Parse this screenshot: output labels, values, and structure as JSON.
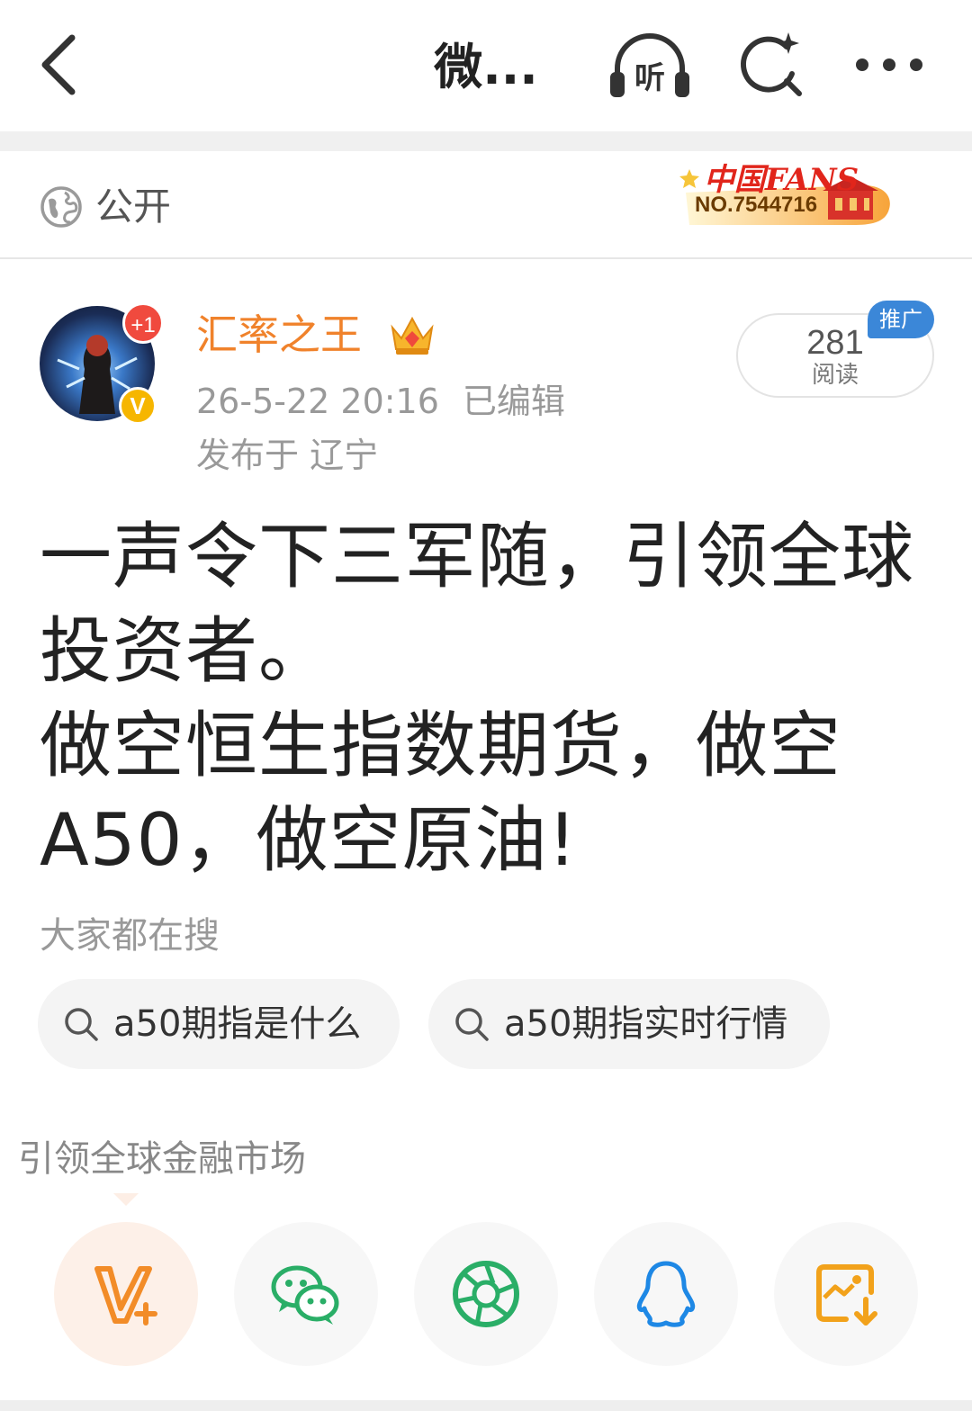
{
  "topbar": {
    "title": "微...",
    "listen_label": "听"
  },
  "visibility": {
    "label": "公开",
    "fans_badge": {
      "title": "中国FANS",
      "number": "NO.7544716"
    }
  },
  "author": {
    "name": "汇率之王",
    "plus_badge": "+1",
    "verified_badge": "V",
    "time": "26-5-22 20:16",
    "edited": "已编辑",
    "location": "发布于 辽宁"
  },
  "reads": {
    "count": "281",
    "label": "阅读",
    "promo_tag": "推广"
  },
  "post": {
    "line1": "一声令下三军随，引领全球",
    "line2": "投资者。",
    "line3": "做空恒生指数期货，做空",
    "line4": "A50，做空原油!"
  },
  "hot_search": {
    "title": "大家都在搜",
    "chips": [
      "a50期指是什么",
      "a50期指实时行情"
    ]
  },
  "share": {
    "title": "引领全球金融市场",
    "targets": [
      "v-plus-icon",
      "wechat-icon",
      "moments-icon",
      "qq-icon",
      "save-image-icon"
    ]
  },
  "colors": {
    "accent_orange": "#f0822b",
    "promo_blue": "#3b87d8",
    "wechat_green": "#2aae67",
    "qq_blue": "#1e88e5"
  }
}
